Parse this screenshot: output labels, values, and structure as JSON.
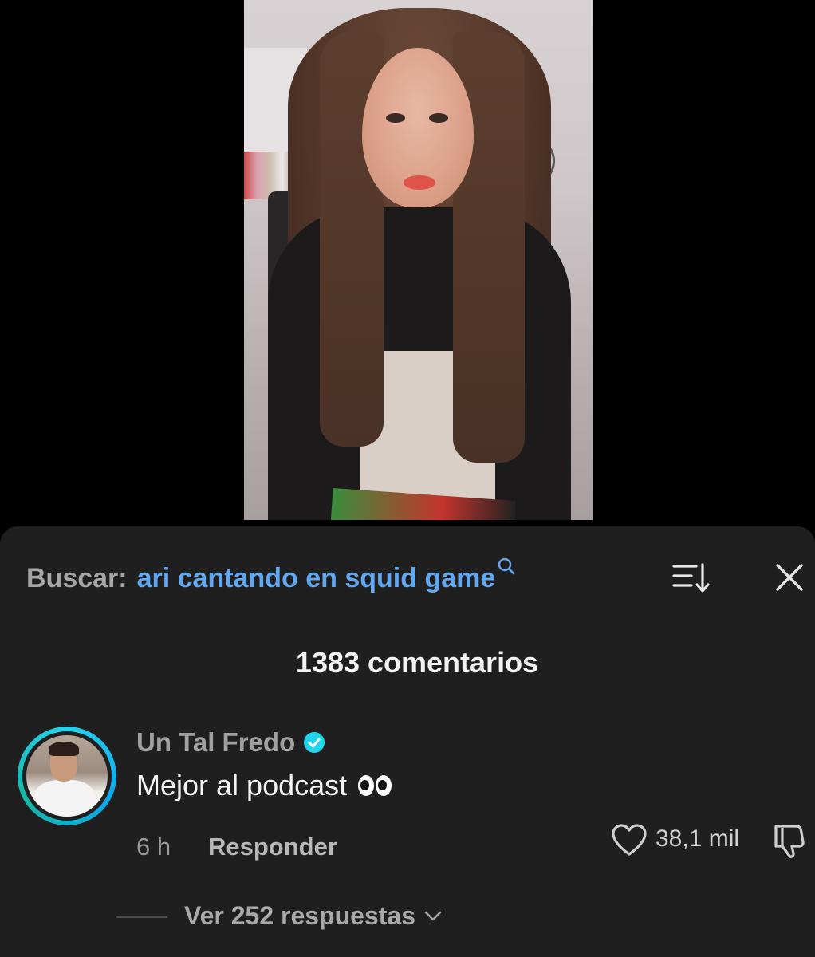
{
  "search": {
    "label": "Buscar:",
    "query": "ari cantando en squid game"
  },
  "comments_header": {
    "count_label": "1383 comentarios"
  },
  "comment": {
    "username": "Un Tal Fredo",
    "verified": true,
    "text": "Mejor al podcast",
    "emoji": "eyes",
    "time": "6 h",
    "reply_label": "Responder",
    "likes": "38,1 mil",
    "view_replies_label": "Ver 252 respuestas"
  },
  "colors": {
    "sheet_bg": "#1f1f1f",
    "search_query": "#62a8f0",
    "verified_badge": "#20d5ec",
    "avatar_ring": "#22d3ee"
  },
  "icons": [
    "search-icon",
    "sort-icon",
    "close-icon",
    "verified-icon",
    "heart-icon",
    "dislike-icon",
    "chevron-down-icon"
  ]
}
